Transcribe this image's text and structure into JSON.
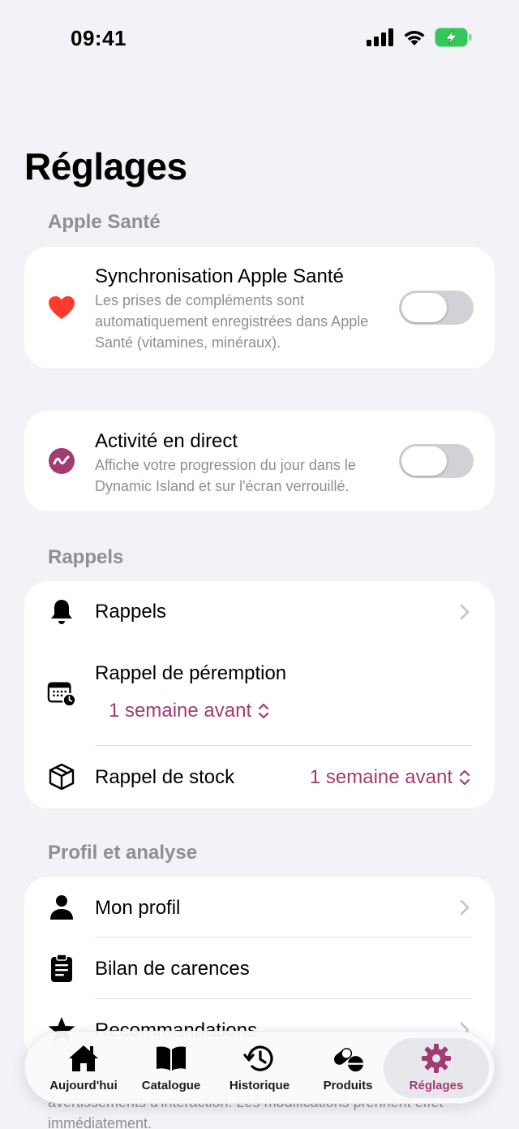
{
  "status": {
    "time": "09:41",
    "icons": [
      "cellular-signal-icon",
      "wifi-icon",
      "battery-charging-icon"
    ]
  },
  "page": {
    "title": "Réglages"
  },
  "colors": {
    "accent": "#A23B72",
    "heart": "#FF3B30",
    "background": "#F2F2F7",
    "secondary": "#8E8E93"
  },
  "sections": {
    "health": {
      "header": "Apple Santé"
    },
    "reminders": {
      "header": "Rappels"
    },
    "profile": {
      "header": "Profil et analyse"
    }
  },
  "health_sync": {
    "title": "Synchronisation Apple Santé",
    "subtitle": "Les prises de compléments sont automatiquement enregistrées dans Apple Santé (vitamines, minéraux).",
    "enabled": false,
    "icon": "heart-icon"
  },
  "live_activity": {
    "title": "Activité en direct",
    "subtitle": "Affiche votre progression du jour dans le Dynamic Island et sur l'écran verrouillé.",
    "enabled": false,
    "icon": "live-activity-icon"
  },
  "reminders": {
    "reminders_row": {
      "title": "Rappels",
      "icon": "bell-icon"
    },
    "expiry_row": {
      "title": "Rappel de péremption",
      "value": "1 semaine avant",
      "icon": "calendar-clock-icon"
    },
    "stock_row": {
      "title": "Rappel de stock",
      "value": "1 semaine avant",
      "icon": "box-icon"
    }
  },
  "profile": {
    "my_profile": {
      "title": "Mon profil",
      "icon": "person-icon"
    },
    "deficiency": {
      "title": "Bilan de carences",
      "icon": "clipboard-icon"
    },
    "recommendations": {
      "title": "Recommandations",
      "icon": "star-icon"
    }
  },
  "footer": {
    "text": "avertissements d'interaction. Les modifications prennent effet immédiatement."
  },
  "tabs": [
    {
      "label": "Aujourd'hui",
      "icon": "house-icon",
      "active": false
    },
    {
      "label": "Catalogue",
      "icon": "book-icon",
      "active": false
    },
    {
      "label": "Historique",
      "icon": "history-icon",
      "active": false
    },
    {
      "label": "Produits",
      "icon": "pills-icon",
      "active": false
    },
    {
      "label": "Réglages",
      "icon": "gear-icon",
      "active": true
    }
  ]
}
